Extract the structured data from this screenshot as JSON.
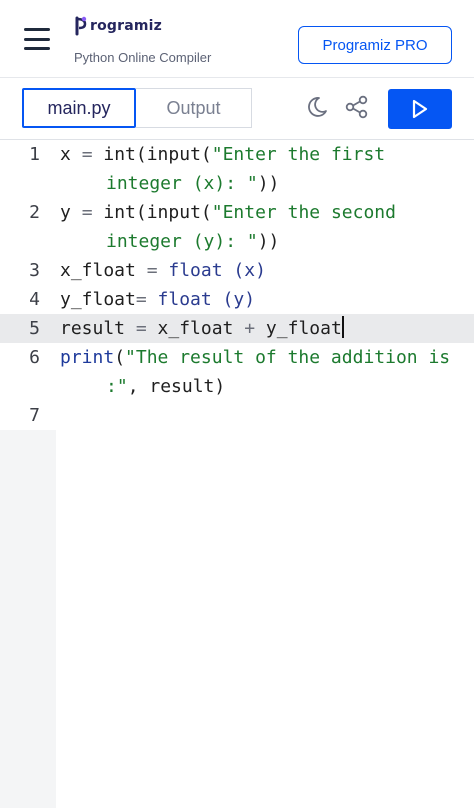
{
  "header": {
    "logo_text": "rogramiz",
    "subtitle": "Python Online Compiler",
    "pro_button": "Programiz PRO"
  },
  "toolbar": {
    "tabs": [
      {
        "label": "main.py",
        "active": true
      },
      {
        "label": "Output",
        "active": false
      }
    ]
  },
  "editor": {
    "lines": [
      {
        "number": "1",
        "text_a": "x ",
        "op1": "=",
        "text_b": " int(input(",
        "str": "\"Enter the first",
        "cont": "integer (x): \"",
        "tail": "))"
      },
      {
        "number": "2",
        "text_a": "y ",
        "op1": "=",
        "text_b": " int(input(",
        "str": "\"Enter the second",
        "cont": "integer (y): \"",
        "tail": "))"
      },
      {
        "number": "3",
        "text_a": "x_float ",
        "op1": "=",
        "text_b": " float (x)"
      },
      {
        "number": "4",
        "text_a": "y_float",
        "op1": "=",
        "text_b": " float (y)"
      },
      {
        "number": "5",
        "text_a": "result ",
        "op1": "=",
        "text_b": " x_float ",
        "op2": "+",
        "text_c": " y_float"
      },
      {
        "number": "6",
        "fn": "print",
        "text_b": "(",
        "str": "\"The result of the addition is",
        "cont": ":\"",
        "tail": ", result)"
      },
      {
        "number": "7"
      }
    ]
  },
  "colors": {
    "accent": "#0556f3",
    "string": "#1c7a2e",
    "highlight_line": "#e9eaec"
  }
}
